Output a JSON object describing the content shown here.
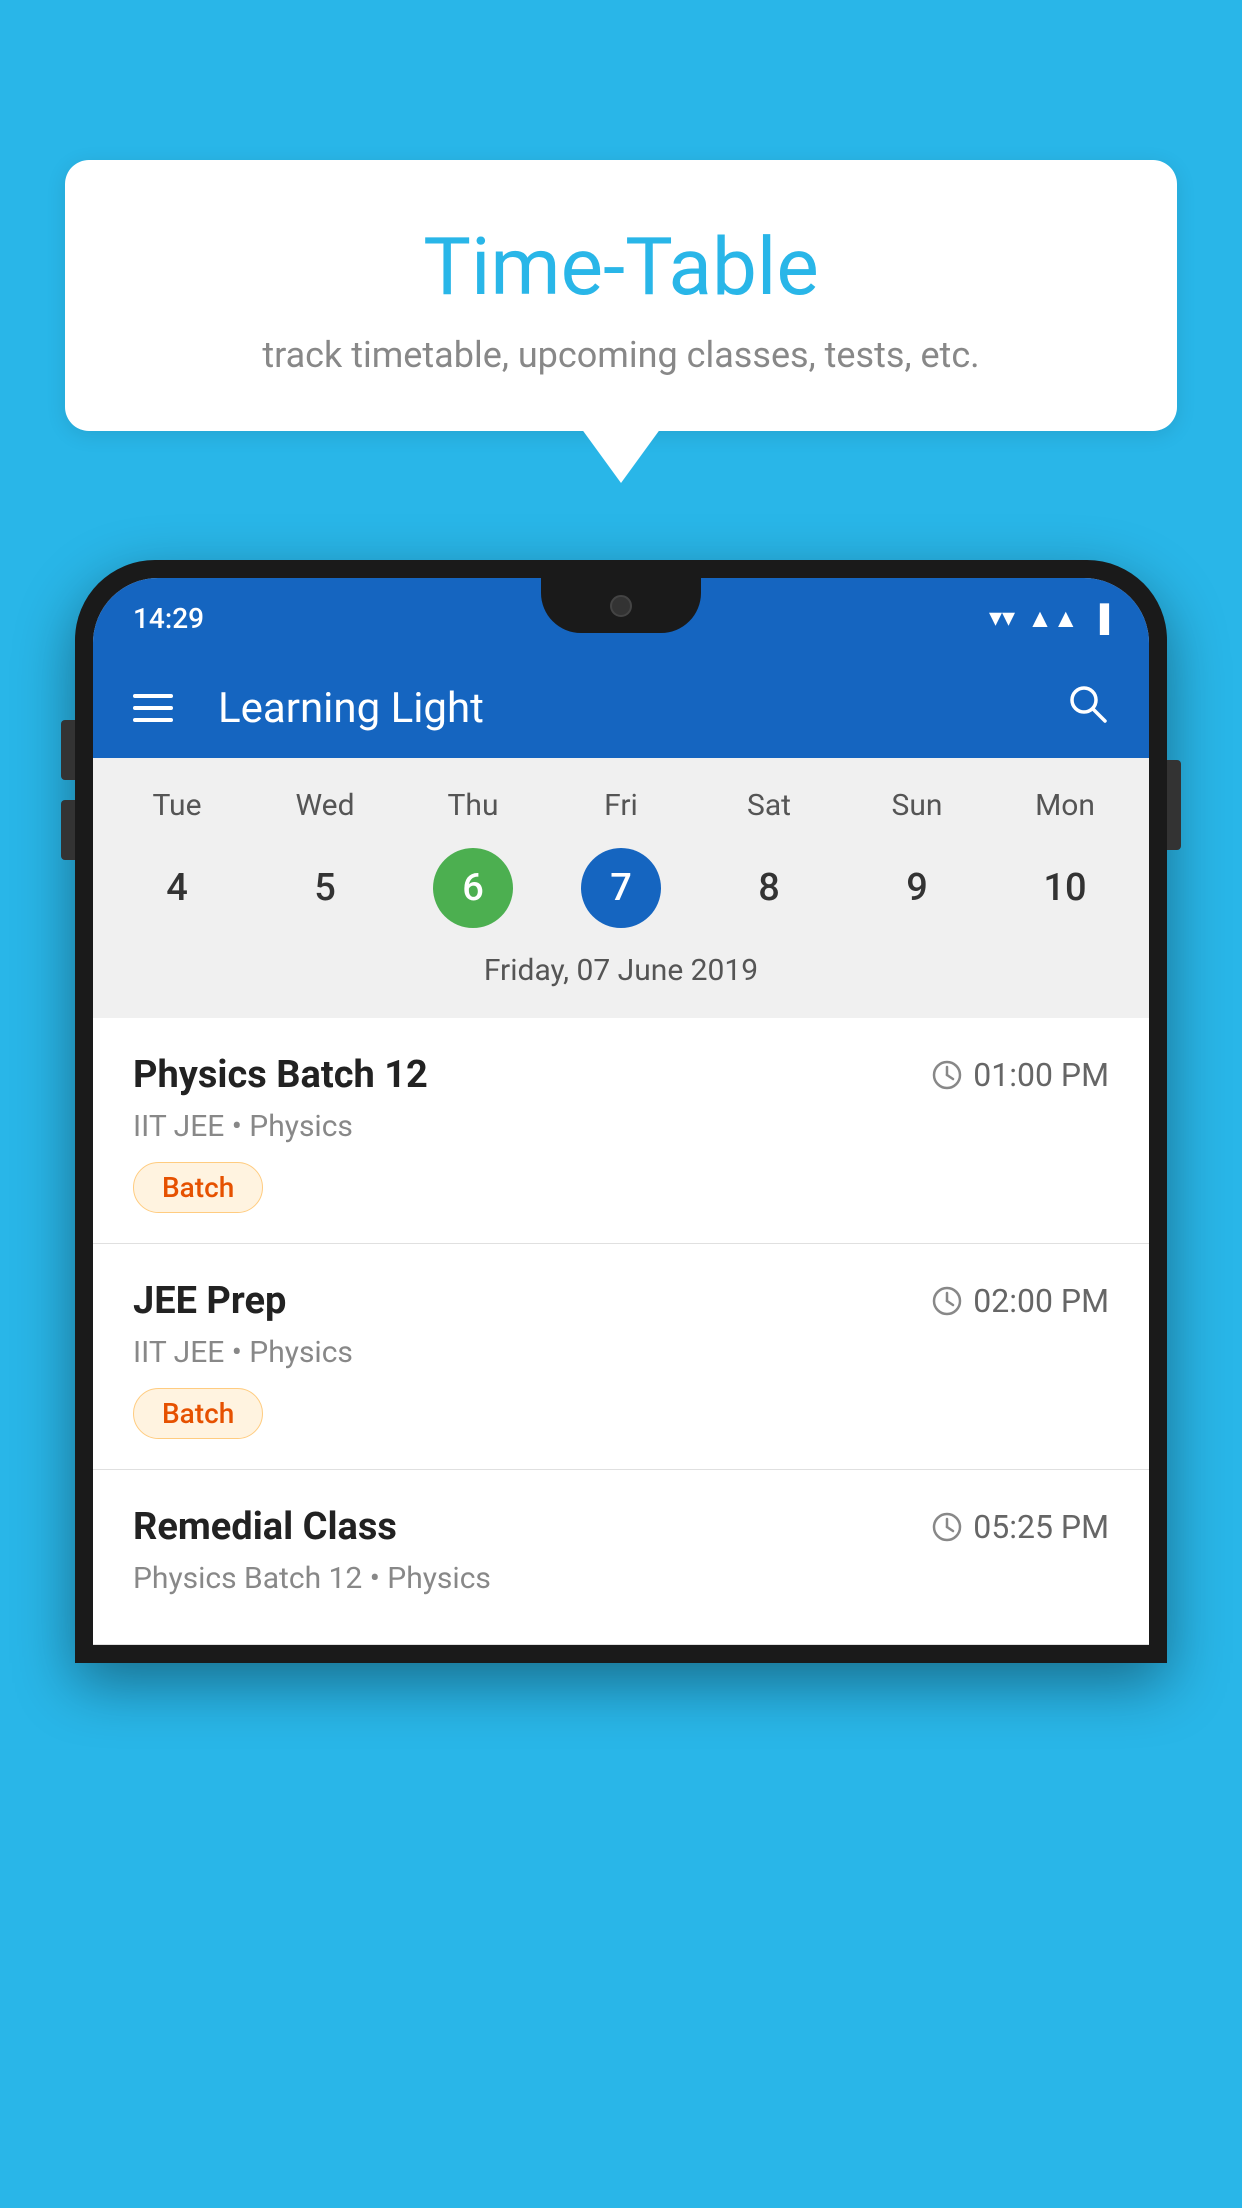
{
  "background_color": "#29B6E8",
  "bubble": {
    "title": "Time-Table",
    "subtitle": "track timetable, upcoming classes, tests, etc."
  },
  "phone": {
    "status_bar": {
      "time": "14:29",
      "icons": [
        "wifi",
        "signal",
        "battery"
      ]
    },
    "app_bar": {
      "title": "Learning Light"
    },
    "calendar": {
      "days": [
        "Tue",
        "Wed",
        "Thu",
        "Fri",
        "Sat",
        "Sun",
        "Mon"
      ],
      "dates": [
        {
          "num": "4",
          "state": "normal"
        },
        {
          "num": "5",
          "state": "normal"
        },
        {
          "num": "6",
          "state": "today"
        },
        {
          "num": "7",
          "state": "selected"
        },
        {
          "num": "8",
          "state": "normal"
        },
        {
          "num": "9",
          "state": "normal"
        },
        {
          "num": "10",
          "state": "normal"
        }
      ],
      "selected_date_label": "Friday, 07 June 2019"
    },
    "schedule": [
      {
        "title": "Physics Batch 12",
        "time": "01:00 PM",
        "subtitle": "IIT JEE • Physics",
        "badge": "Batch"
      },
      {
        "title": "JEE Prep",
        "time": "02:00 PM",
        "subtitle": "IIT JEE • Physics",
        "badge": "Batch"
      },
      {
        "title": "Remedial Class",
        "time": "05:25 PM",
        "subtitle": "Physics Batch 12 • Physics",
        "badge": null
      }
    ]
  }
}
